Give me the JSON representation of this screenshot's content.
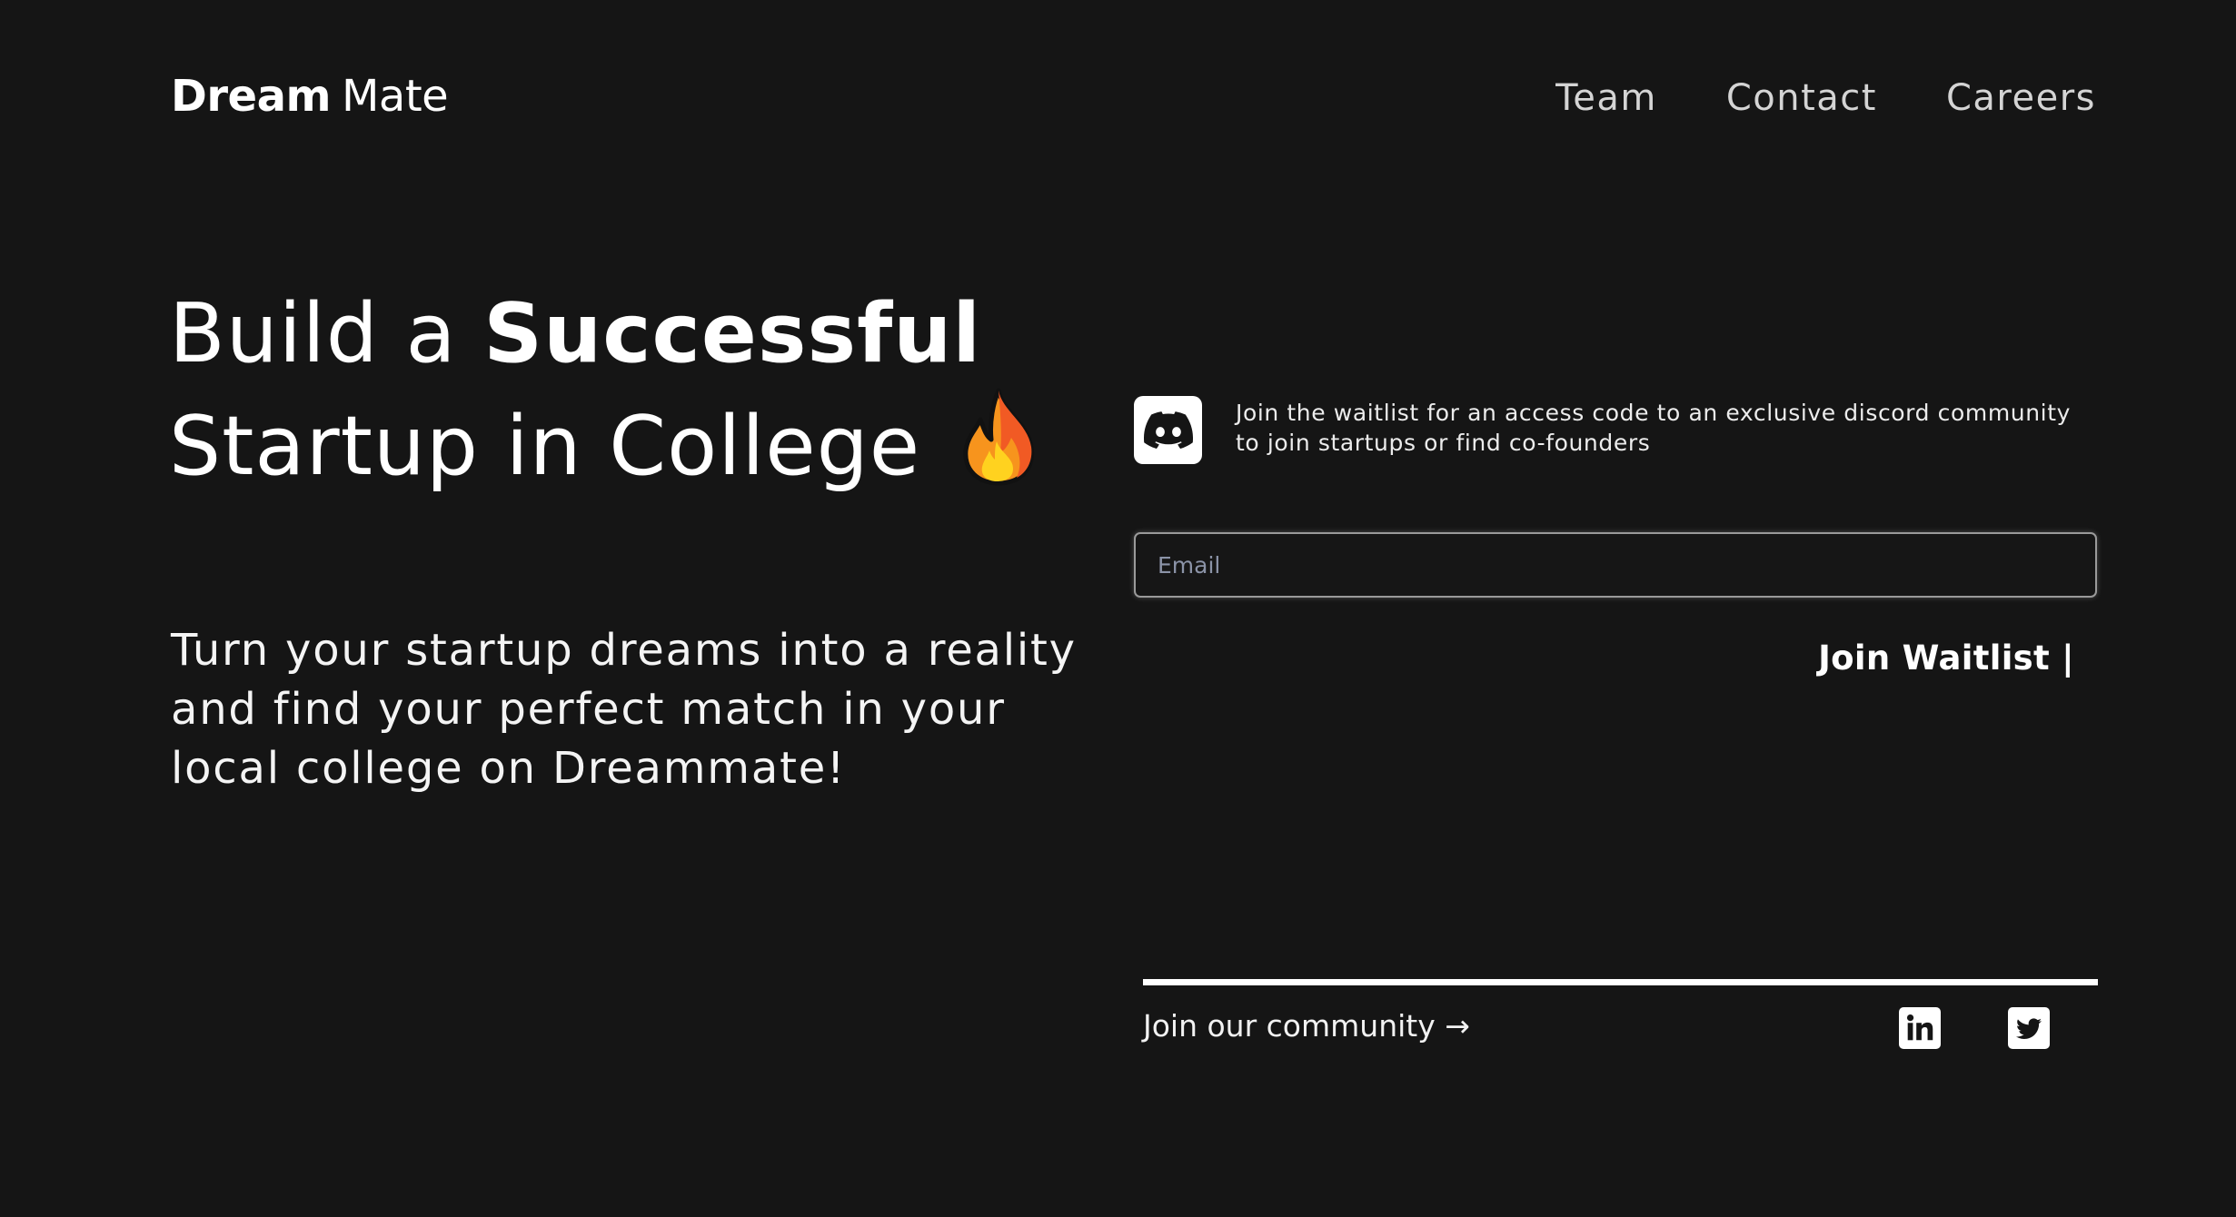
{
  "header": {
    "logo_bold": "Dream",
    "logo_light": "Mate",
    "nav": [
      {
        "label": "Team"
      },
      {
        "label": "Contact"
      },
      {
        "label": "Careers"
      }
    ]
  },
  "hero": {
    "title_line1_prefix": "Build a ",
    "title_line1_bold": "Successful",
    "title_line2": "Startup in College",
    "title_icon": "fire-emoji-icon",
    "subtitle": "Turn your startup dreams into a reality and find your perfect match in your local college on Dreammate!"
  },
  "waitlist": {
    "badge_icon": "discord-icon",
    "description": "Join the waitlist for an access code to an exclusive discord community to join startups or find co-founders",
    "email_placeholder": "Email",
    "email_value": "",
    "button_label": "Join Waitlist |"
  },
  "community": {
    "link_label": "Join our community →",
    "socials": [
      {
        "icon": "linkedin-icon"
      },
      {
        "icon": "twitter-icon"
      }
    ]
  },
  "colors": {
    "background": "#151515",
    "text": "#ffffff",
    "nav_text": "#d4d4d4",
    "placeholder": "#8b93a7"
  }
}
